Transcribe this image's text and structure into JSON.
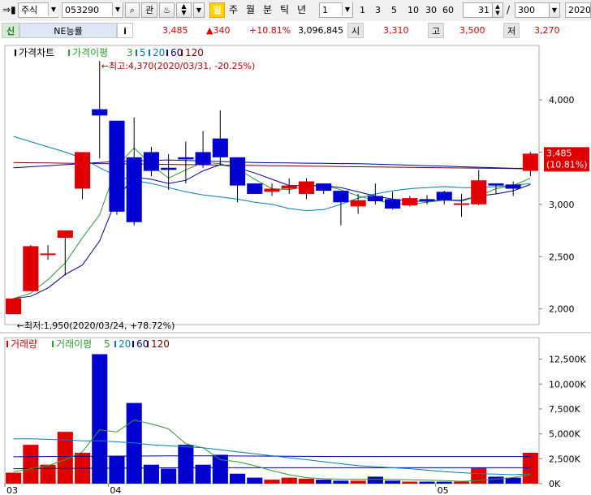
{
  "toolbar": {
    "market": "주식",
    "code": "053290",
    "search_icon": "search-icon",
    "gwan": "관",
    "period_selected": "일",
    "periods": [
      "주",
      "월",
      "분",
      "틱",
      "년"
    ],
    "interval": "1",
    "intervals": [
      "1",
      "3",
      "5",
      "10",
      "30",
      "60"
    ],
    "count": "31",
    "separator": "/",
    "total": "300",
    "date": "2020/"
  },
  "quote": {
    "badge": "신",
    "name": "NE능률",
    "info": "i",
    "price": "3,485",
    "change": "▲340",
    "rate": "+10.81%",
    "volume": "3,096,845",
    "open_label": "시",
    "open": "3,310",
    "high_label": "고",
    "high": "3,500",
    "low_label": "저",
    "low": "3,270"
  },
  "colors": {
    "up": "#e00000",
    "down": "#0000d0",
    "ma5": "#2e9e2e",
    "ma20": "#0080c0",
    "ma60": "#0000b0",
    "ma120": "#800000"
  },
  "chart_data": [
    {
      "type": "candlestick",
      "legend": [
        "가격차트",
        "가격이평",
        "3",
        "5",
        "20",
        "60",
        "120"
      ],
      "annotation_high": "←최고:4,370(2020/03/31, -20.25%)",
      "annotation_low": "←최저:1,950(2020/03/24, +78.72%)",
      "last_label": "3,485",
      "last_rate": "(10.81%)",
      "x_labels": [
        {
          "i": 0,
          "t": "03"
        },
        {
          "i": 6,
          "t": "04"
        },
        {
          "i": 25,
          "t": "05"
        }
      ],
      "yticks": [
        2000,
        2500,
        3000,
        3500,
        4000
      ],
      "ytick_labels": [
        "2,000",
        "2,500",
        "3,000",
        "3,500",
        "4,000"
      ],
      "ylim": [
        1850,
        4520
      ],
      "ohlc": [
        [
          1950,
          2100,
          1950,
          2100
        ],
        [
          2170,
          2600,
          2170,
          2610
        ],
        [
          2520,
          2530,
          2470,
          2610
        ],
        [
          2680,
          2750,
          2320,
          2750
        ],
        [
          3150,
          3500,
          3050,
          3500
        ],
        [
          3910,
          3850,
          3440,
          4370
        ],
        [
          3800,
          2930,
          2900,
          3800
        ],
        [
          3450,
          2830,
          2800,
          3830
        ],
        [
          3500,
          3320,
          3270,
          3550
        ],
        [
          3350,
          3330,
          3140,
          3480
        ],
        [
          3450,
          3430,
          3200,
          3600
        ],
        [
          3500,
          3380,
          3350,
          3700
        ],
        [
          3630,
          3450,
          3380,
          3900
        ],
        [
          3450,
          3180,
          3020,
          3450
        ],
        [
          3200,
          3100,
          3100,
          3200
        ],
        [
          3120,
          3150,
          3080,
          3200
        ],
        [
          3150,
          3180,
          3100,
          3250
        ],
        [
          3100,
          3220,
          3050,
          3250
        ],
        [
          3200,
          3130,
          3100,
          3200
        ],
        [
          3130,
          3020,
          2800,
          3130
        ],
        [
          2980,
          3040,
          2910,
          3100
        ],
        [
          3080,
          3030,
          3000,
          3200
        ],
        [
          3050,
          2960,
          2950,
          3120
        ],
        [
          2990,
          3060,
          2980,
          3080
        ],
        [
          3050,
          3040,
          3000,
          3090
        ],
        [
          3120,
          3040,
          3000,
          3130
        ],
        [
          3010,
          3010,
          2880,
          3100
        ],
        [
          3000,
          3230,
          2990,
          3330
        ],
        [
          3200,
          3180,
          3100,
          3200
        ],
        [
          3190,
          3150,
          3080,
          3220
        ],
        [
          3320,
          3485,
          3270,
          3500
        ]
      ],
      "ma3": [
        2100,
        2150,
        2280,
        2440,
        2680,
        2900,
        3370,
        3540,
        3380,
        3250,
        3330,
        3400,
        3390,
        3340,
        3240,
        3150,
        3140,
        3170,
        3180,
        3140,
        3080,
        3040,
        3010,
        3000,
        3020,
        3040,
        3030,
        3080,
        3150,
        3180,
        3250
      ],
      "ma5": [
        2100,
        2120,
        2200,
        2330,
        2420,
        2650,
        3060,
        3260,
        3240,
        3200,
        3230,
        3320,
        3380,
        3350,
        3300,
        3240,
        3180,
        3180,
        3180,
        3160,
        3120,
        3080,
        3050,
        3030,
        3030,
        3040,
        3040,
        3080,
        3100,
        3130,
        3190
      ],
      "ma20": [
        3650,
        3600,
        3550,
        3500,
        3440,
        3350,
        3270,
        3230,
        3200,
        3160,
        3120,
        3090,
        3070,
        3050,
        3020,
        3000,
        2960,
        2940,
        2950,
        3000,
        3060,
        3100,
        3130,
        3150,
        3160,
        3170,
        3160,
        3160,
        3170,
        3180,
        3200
      ],
      "ma60": [
        3350,
        3360,
        3370,
        3380,
        3390,
        3400,
        3410,
        3415,
        3420,
        3425,
        3420,
        3415,
        3410,
        3405,
        3400,
        3398,
        3396,
        3394,
        3392,
        3390,
        3388,
        3385,
        3380,
        3375,
        3370,
        3365,
        3360,
        3355,
        3350,
        3345,
        3345
      ],
      "ma120": [
        3400,
        3398,
        3396,
        3394,
        3392,
        3390,
        3388,
        3386,
        3384,
        3382,
        3380,
        3378,
        3376,
        3374,
        3372,
        3370,
        3368,
        3366,
        3364,
        3362,
        3360,
        3358,
        3356,
        3354,
        3352,
        3350,
        3348,
        3346,
        3344,
        3342,
        3340
      ]
    },
    {
      "type": "bar",
      "legend": [
        "거래량",
        "거래이평",
        "5",
        "20",
        "60",
        "120"
      ],
      "yticks": [
        0,
        2500,
        5000,
        7500,
        10000,
        12500
      ],
      "ytick_labels": [
        "0K",
        "2,500K",
        "5,000K",
        "7,500K",
        "10,000K",
        "12,500K"
      ],
      "ylim": [
        0,
        13200
      ],
      "volumes": [
        1100,
        3900,
        1900,
        5200,
        3100,
        13000,
        2800,
        8100,
        1900,
        1500,
        3900,
        1900,
        2900,
        1000,
        600,
        400,
        600,
        500,
        400,
        300,
        300,
        700,
        300,
        200,
        200,
        200,
        200,
        1600,
        700,
        600,
        3100
      ],
      "ma5": [
        1200,
        1500,
        1800,
        2400,
        3200,
        5400,
        5200,
        6400,
        6000,
        5500,
        4000,
        3600,
        2400,
        2200,
        1800,
        1300,
        900,
        600,
        500,
        450,
        440,
        440,
        420,
        380,
        340,
        300,
        240,
        320,
        450,
        620,
        920
      ],
      "ma20": [
        4500,
        4500,
        4450,
        4400,
        4300,
        4300,
        4200,
        4100,
        3900,
        3800,
        3700,
        3600,
        3400,
        3200,
        3000,
        2800,
        2600,
        2400,
        2200,
        2000,
        1800,
        1700,
        1600,
        1500,
        1350,
        1200,
        1100,
        1000,
        950,
        900,
        1000
      ],
      "ma60": [
        2700,
        2710,
        2720,
        2730,
        2740,
        2750,
        2760,
        2770,
        2780,
        2790,
        2790,
        2790,
        2790,
        2780,
        2770,
        2760,
        2750,
        2740,
        2730,
        2720,
        2720,
        2720,
        2720,
        2720,
        2720,
        2720,
        2720,
        2720,
        2720,
        2720,
        2720
      ],
      "ma120": [
        1500,
        1510,
        1520,
        1530,
        1540,
        1550,
        1560,
        1570,
        1580,
        1590,
        1600,
        1600,
        1600,
        1600,
        1600,
        1600,
        1600,
        1600,
        1600,
        1600,
        1600,
        1600,
        1600,
        1600,
        1600,
        1600,
        1600,
        1600,
        1600,
        1600,
        1600
      ]
    }
  ]
}
